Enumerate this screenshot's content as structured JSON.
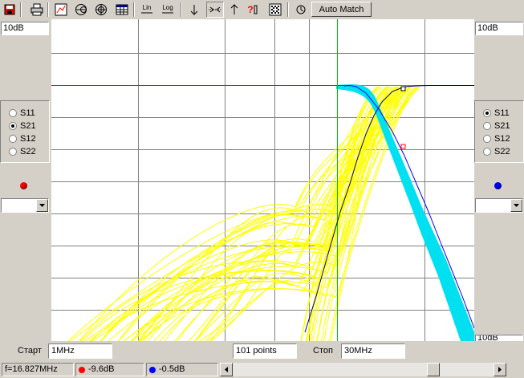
{
  "toolbar": {
    "icons": [
      "save-icon",
      "print-icon",
      "chart-icon",
      "smith-chart-icon",
      "polar-icon",
      "table-icon",
      "linear-scale-icon",
      "log-scale-icon",
      "arrow-down-icon",
      "zoom-icon",
      "arrow-up-icon",
      "help-icon",
      "settings-icon",
      "reset-icon"
    ],
    "lin_label": "Lin",
    "log_label": "Log",
    "help_label": "?",
    "auto_match_label": "Auto Match"
  },
  "left_panel": {
    "scale": "10dB",
    "radios": [
      "S11",
      "S21",
      "S12",
      "S22"
    ],
    "selected": "S21",
    "marker_color": "#ff0000"
  },
  "right_panel": {
    "scale": "10dB",
    "radios": [
      "S11",
      "S21",
      "S12",
      "S22"
    ],
    "selected": "S11",
    "marker_color": "#0000ff",
    "bottom_scale_partial": "10dB"
  },
  "bottom_bar": {
    "start_label": "Старт",
    "start_value": "1MHz",
    "points_value": "101 points",
    "stop_label": "Стоп",
    "stop_value": "30MHz"
  },
  "status_bar": {
    "frequency": "f=16.827MHz",
    "red_marker_value": "-9.6dB",
    "blue_marker_value": "-0.5dB"
  },
  "colors": {
    "grid": "#808080",
    "ref_line": "#ff0000",
    "cursor": "#00c000",
    "yellow_traces": "#ffff00",
    "cyan_band": "#00e0f0",
    "s21_trace": "#000080",
    "s11_trace": "#0000ff"
  }
}
